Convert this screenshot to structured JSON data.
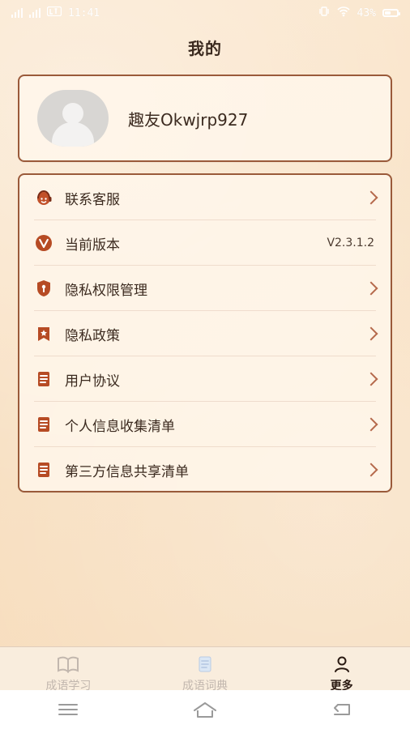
{
  "status_bar": {
    "time": "11:41",
    "battery": "43%",
    "left_icons": [
      "signal-icon",
      "signal-icon",
      "lte-icon"
    ],
    "right_icons": [
      "vibrate-icon",
      "wifi-icon",
      "battery-icon"
    ]
  },
  "header": {
    "title": "我的"
  },
  "profile": {
    "username": "趣友Okwjrp927"
  },
  "menu": {
    "items": [
      {
        "label": "联系客服",
        "icon": "customer-service-icon",
        "right_text": "",
        "chevron": true
      },
      {
        "label": "当前版本",
        "icon": "version-icon",
        "right_text": "V2.3.1.2",
        "chevron": false
      },
      {
        "label": "隐私权限管理",
        "icon": "privacy-shield-icon",
        "right_text": "",
        "chevron": true
      },
      {
        "label": "隐私政策",
        "icon": "privacy-policy-icon",
        "right_text": "",
        "chevron": true
      },
      {
        "label": "用户协议",
        "icon": "document-icon",
        "right_text": "",
        "chevron": true
      },
      {
        "label": "个人信息收集清单",
        "icon": "document-icon",
        "right_text": "",
        "chevron": true
      },
      {
        "label": "第三方信息共享清单",
        "icon": "document-icon",
        "right_text": "",
        "chevron": true
      }
    ]
  },
  "bottom_tabs": [
    {
      "label": "成语学习",
      "icon": "book-icon",
      "active": false
    },
    {
      "label": "成语词典",
      "icon": "dictionary-icon",
      "active": false
    },
    {
      "label": "更多",
      "icon": "user-icon",
      "active": true
    }
  ],
  "system_nav": {
    "buttons": [
      "menu-icon",
      "home-icon",
      "back-icon"
    ]
  },
  "colors": {
    "background": "#f9e3c7",
    "card_border": "#9a5a3a",
    "accent": "#b64b24",
    "chevron": "#b5694b",
    "inactive_tab": "#c2b7ae"
  }
}
